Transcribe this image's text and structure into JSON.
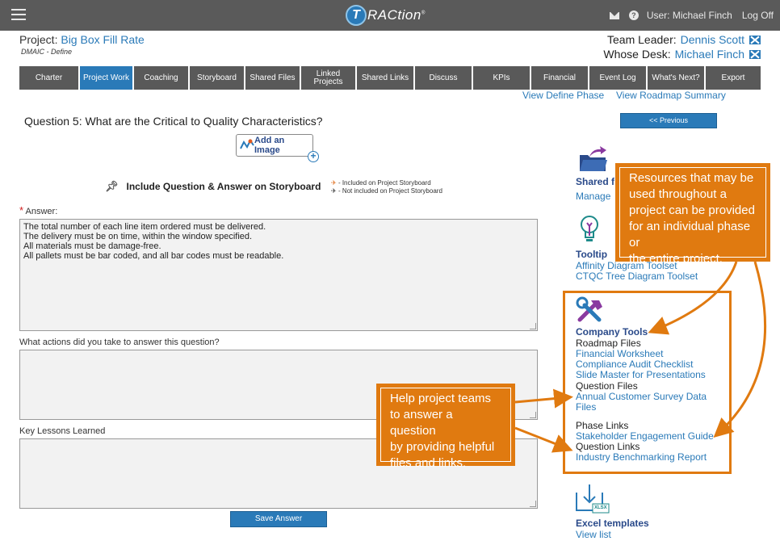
{
  "app": {
    "logo_text": "RACtion",
    "logo_letter": "T",
    "user_label": "User: Michael Finch",
    "logoff_label": "Log Off"
  },
  "header": {
    "project_label": "Project:",
    "project_name": "Big Box Fill Rate",
    "phase": "DMAIC - Define",
    "team_leader_label": "Team Leader:",
    "team_leader": "Dennis Scott",
    "whose_desk_label": "Whose Desk:",
    "whose_desk": "Michael Finch"
  },
  "tabs": [
    {
      "label": "Charter"
    },
    {
      "label": "Project Work",
      "active": true
    },
    {
      "label": "Coaching"
    },
    {
      "label": "Storyboard"
    },
    {
      "label": "Shared Files"
    },
    {
      "label": "Linked Projects"
    },
    {
      "label": "Shared Links"
    },
    {
      "label": "Discuss"
    },
    {
      "label": "KPIs"
    },
    {
      "label": "Financial"
    },
    {
      "label": "Event Log"
    },
    {
      "label": "What's Next?"
    },
    {
      "label": "Export"
    }
  ],
  "sublinks": {
    "define_phase": "View Define Phase",
    "roadmap_summary": "View Roadmap Summary"
  },
  "question": {
    "title": "Question 5: What are the Critical to Quality Characteristics?",
    "add_image_label": "Add an Image",
    "include_label": "Include Question & Answer on Storyboard",
    "legend_included": "- Included on Project Storyboard",
    "legend_not_included": "- Not included on Project Storyboard",
    "answer_label": "Answer:",
    "answer_required_mark": "*",
    "answer_text": "The total number of each line item ordered must be delivered.\nThe delivery must be on time, within the window specified.\nAll materials must be damage-free.\nAll pallets must be bar coded, and all bar codes must be readable.",
    "actions_label": "What actions did you take to answer this question?",
    "actions_text": "",
    "lessons_label": "Key Lessons Learned",
    "lessons_text": "",
    "save_label": "Save Answer"
  },
  "right": {
    "previous_label": "<< Previous",
    "shared_title": "Shared f",
    "shared_link": "Manage",
    "tooltip_title": "Tooltip",
    "tooltip_links": [
      "Affinity Diagram Toolset",
      "CTQC Tree Diagram Toolset"
    ],
    "company_tools_title": "Company Tools",
    "roadmap_files_label": "Roadmap Files",
    "roadmap_files": [
      "Financial Worksheet",
      "Compliance Audit Checklist",
      "Slide Master for Presentations"
    ],
    "question_files_label": "Question Files",
    "question_files": [
      "Annual Customer Survey Data",
      "Files"
    ],
    "phase_links_label": "Phase Links",
    "phase_links": [
      "Stakeholder Engagement Guide"
    ],
    "question_links_label": "Question Links",
    "question_links": [
      "Industry Benchmarking Report"
    ],
    "excel_title": "Excel templates",
    "excel_link": "View list",
    "excel_icon_text": "XLSX"
  },
  "callouts": {
    "resources": [
      "Resources that may be",
      "used throughout a",
      "project can be provided",
      "for an individual phase or",
      "the entire project."
    ],
    "help": [
      "Help project teams",
      "to answer a question",
      "by providing helpful",
      "files and links."
    ]
  },
  "colors": {
    "topbar": "#5a5a5a",
    "tab": "#595959",
    "accent": "#2a7ab8",
    "callout": "#e07a10"
  }
}
